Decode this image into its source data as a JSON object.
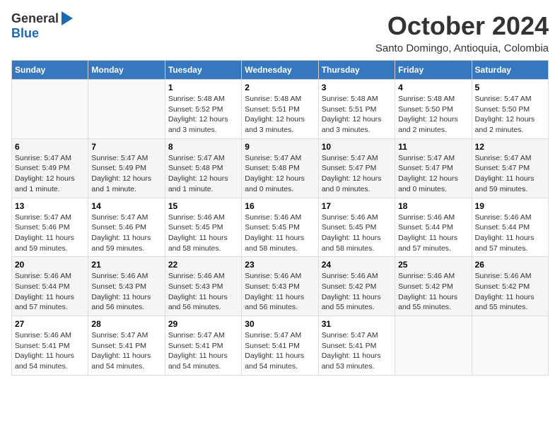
{
  "logo": {
    "general": "General",
    "blue": "Blue"
  },
  "header": {
    "month": "October 2024",
    "location": "Santo Domingo, Antioquia, Colombia"
  },
  "weekdays": [
    "Sunday",
    "Monday",
    "Tuesday",
    "Wednesday",
    "Thursday",
    "Friday",
    "Saturday"
  ],
  "weeks": [
    [
      {
        "day": "",
        "info": ""
      },
      {
        "day": "",
        "info": ""
      },
      {
        "day": "1",
        "info": "Sunrise: 5:48 AM\nSunset: 5:52 PM\nDaylight: 12 hours\nand 3 minutes."
      },
      {
        "day": "2",
        "info": "Sunrise: 5:48 AM\nSunset: 5:51 PM\nDaylight: 12 hours\nand 3 minutes."
      },
      {
        "day": "3",
        "info": "Sunrise: 5:48 AM\nSunset: 5:51 PM\nDaylight: 12 hours\nand 3 minutes."
      },
      {
        "day": "4",
        "info": "Sunrise: 5:48 AM\nSunset: 5:50 PM\nDaylight: 12 hours\nand 2 minutes."
      },
      {
        "day": "5",
        "info": "Sunrise: 5:47 AM\nSunset: 5:50 PM\nDaylight: 12 hours\nand 2 minutes."
      }
    ],
    [
      {
        "day": "6",
        "info": "Sunrise: 5:47 AM\nSunset: 5:49 PM\nDaylight: 12 hours\nand 1 minute."
      },
      {
        "day": "7",
        "info": "Sunrise: 5:47 AM\nSunset: 5:49 PM\nDaylight: 12 hours\nand 1 minute."
      },
      {
        "day": "8",
        "info": "Sunrise: 5:47 AM\nSunset: 5:48 PM\nDaylight: 12 hours\nand 1 minute."
      },
      {
        "day": "9",
        "info": "Sunrise: 5:47 AM\nSunset: 5:48 PM\nDaylight: 12 hours\nand 0 minutes."
      },
      {
        "day": "10",
        "info": "Sunrise: 5:47 AM\nSunset: 5:47 PM\nDaylight: 12 hours\nand 0 minutes."
      },
      {
        "day": "11",
        "info": "Sunrise: 5:47 AM\nSunset: 5:47 PM\nDaylight: 12 hours\nand 0 minutes."
      },
      {
        "day": "12",
        "info": "Sunrise: 5:47 AM\nSunset: 5:47 PM\nDaylight: 11 hours\nand 59 minutes."
      }
    ],
    [
      {
        "day": "13",
        "info": "Sunrise: 5:47 AM\nSunset: 5:46 PM\nDaylight: 11 hours\nand 59 minutes."
      },
      {
        "day": "14",
        "info": "Sunrise: 5:47 AM\nSunset: 5:46 PM\nDaylight: 11 hours\nand 59 minutes."
      },
      {
        "day": "15",
        "info": "Sunrise: 5:46 AM\nSunset: 5:45 PM\nDaylight: 11 hours\nand 58 minutes."
      },
      {
        "day": "16",
        "info": "Sunrise: 5:46 AM\nSunset: 5:45 PM\nDaylight: 11 hours\nand 58 minutes."
      },
      {
        "day": "17",
        "info": "Sunrise: 5:46 AM\nSunset: 5:45 PM\nDaylight: 11 hours\nand 58 minutes."
      },
      {
        "day": "18",
        "info": "Sunrise: 5:46 AM\nSunset: 5:44 PM\nDaylight: 11 hours\nand 57 minutes."
      },
      {
        "day": "19",
        "info": "Sunrise: 5:46 AM\nSunset: 5:44 PM\nDaylight: 11 hours\nand 57 minutes."
      }
    ],
    [
      {
        "day": "20",
        "info": "Sunrise: 5:46 AM\nSunset: 5:44 PM\nDaylight: 11 hours\nand 57 minutes."
      },
      {
        "day": "21",
        "info": "Sunrise: 5:46 AM\nSunset: 5:43 PM\nDaylight: 11 hours\nand 56 minutes."
      },
      {
        "day": "22",
        "info": "Sunrise: 5:46 AM\nSunset: 5:43 PM\nDaylight: 11 hours\nand 56 minutes."
      },
      {
        "day": "23",
        "info": "Sunrise: 5:46 AM\nSunset: 5:43 PM\nDaylight: 11 hours\nand 56 minutes."
      },
      {
        "day": "24",
        "info": "Sunrise: 5:46 AM\nSunset: 5:42 PM\nDaylight: 11 hours\nand 55 minutes."
      },
      {
        "day": "25",
        "info": "Sunrise: 5:46 AM\nSunset: 5:42 PM\nDaylight: 11 hours\nand 55 minutes."
      },
      {
        "day": "26",
        "info": "Sunrise: 5:46 AM\nSunset: 5:42 PM\nDaylight: 11 hours\nand 55 minutes."
      }
    ],
    [
      {
        "day": "27",
        "info": "Sunrise: 5:46 AM\nSunset: 5:41 PM\nDaylight: 11 hours\nand 54 minutes."
      },
      {
        "day": "28",
        "info": "Sunrise: 5:47 AM\nSunset: 5:41 PM\nDaylight: 11 hours\nand 54 minutes."
      },
      {
        "day": "29",
        "info": "Sunrise: 5:47 AM\nSunset: 5:41 PM\nDaylight: 11 hours\nand 54 minutes."
      },
      {
        "day": "30",
        "info": "Sunrise: 5:47 AM\nSunset: 5:41 PM\nDaylight: 11 hours\nand 54 minutes."
      },
      {
        "day": "31",
        "info": "Sunrise: 5:47 AM\nSunset: 5:41 PM\nDaylight: 11 hours\nand 53 minutes."
      },
      {
        "day": "",
        "info": ""
      },
      {
        "day": "",
        "info": ""
      }
    ]
  ]
}
